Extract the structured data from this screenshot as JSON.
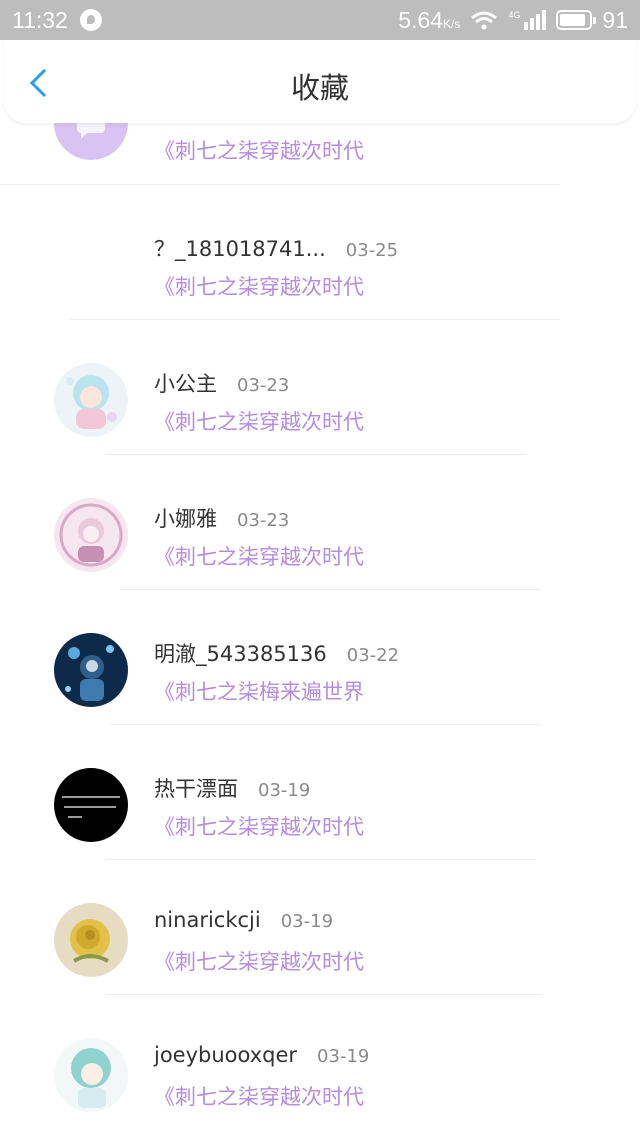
{
  "status_bar": {
    "time": "11:32",
    "speed": "5.64",
    "speed_unit": "K/s",
    "network": "4G",
    "battery": "91",
    "battery_level": 0.91
  },
  "header": {
    "title": "收藏"
  },
  "partial_item": {
    "book": "《刺七之柒穿越次时代"
  },
  "items": [
    {
      "name": "？_181018741...",
      "date": "03-25",
      "book": "《刺七之柒穿越次时代"
    },
    {
      "name": "小公主",
      "date": "03-23",
      "book": "《刺七之柒穿越次时代"
    },
    {
      "name": "小娜雅",
      "date": "03-23",
      "book": "《刺七之柒穿越次时代"
    },
    {
      "name": "明澈_543385136",
      "date": "03-22",
      "book": "《刺七之柒梅来遍世界"
    },
    {
      "name": "热干漂面",
      "date": "03-19",
      "book": "《刺七之柒穿越次时代"
    },
    {
      "name": "ninarickcji",
      "date": "03-19",
      "book": "《刺七之柒穿越次时代"
    },
    {
      "name": "joeybuooxqer",
      "date": "03-19",
      "book": "《刺七之柒穿越次时代"
    }
  ],
  "colors": {
    "accent": "#2aa2f0",
    "book_title": "#b48ce0",
    "status_bar": "#bdbdbd"
  }
}
